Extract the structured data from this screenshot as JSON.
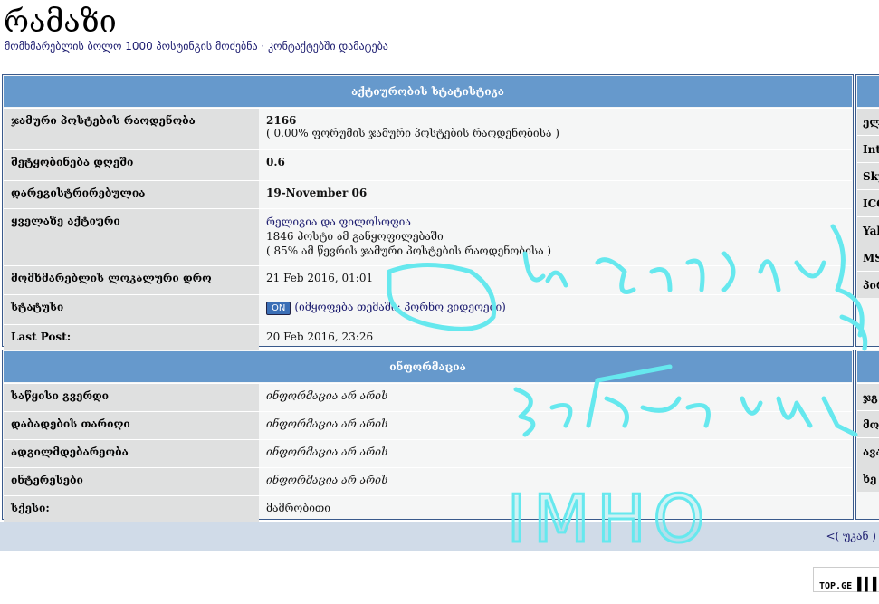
{
  "header": {
    "title": "რამაზი",
    "subtitle": "მომხმარებლის ბოლო 1000 პოსტინგის მოძებნა · კონტაქტებში დამატება"
  },
  "stats": {
    "title": "აქტიურობის სტატისტიკა",
    "rows": [
      {
        "label": "ჯამური პოსტების რაოდენობა",
        "value": "2166",
        "note": "( 0.00% ფორუმის ჯამური პოსტების რაოდენობისა )"
      },
      {
        "label": "შეტყობინება დღეში",
        "value": "0.6"
      },
      {
        "label": "დარეგისტრირებულია",
        "value": "19-November 06"
      },
      {
        "label": "ყველაზე აქტიური",
        "forum": "რელიგია და ფილოსოფია",
        "posts": "1846 პოსტი ამ განყოფილებაში",
        "pct": "( 85% ამ წევრის ჯამური პოსტების რაოდენობისა )"
      },
      {
        "label": "მომხმარებლის ლოკალური დრო",
        "value": "21 Feb 2016, 01:01"
      },
      {
        "label": "სტატუსი",
        "badge": "ON",
        "value": "(იმყოფება თემაში: პორნო ვიდეოები)"
      },
      {
        "label": "Last Post:",
        "value": "20 Feb 2016, 23:26"
      }
    ]
  },
  "info": {
    "title": "ინფორმაცია",
    "rows": [
      {
        "label": "საწყისი გვერდი",
        "value": "ინფორმაცია არ არის"
      },
      {
        "label": "დაბადების თარიღი",
        "value": "ინფორმაცია არ არის"
      },
      {
        "label": "ადგილმდებარეობა",
        "value": "ინფორმაცია არ არის"
      },
      {
        "label": "ინტერესები",
        "value": "ინფორმაცია არ არის"
      },
      {
        "label": "სქესი:",
        "value": "მამრობითი"
      }
    ]
  },
  "contact_partial": [
    "ელ",
    "Int",
    "Sky",
    "ICQ",
    "Yal",
    "MS",
    "პირ"
  ],
  "other_partial": [
    "ჯგ",
    "მოი",
    "ავა",
    "ხე"
  ],
  "footer": {
    "back": "<( უკან )"
  },
  "badge": "TOP.GE",
  "annotation": {
    "text": "IMHO",
    "color": "#66e8ee"
  }
}
